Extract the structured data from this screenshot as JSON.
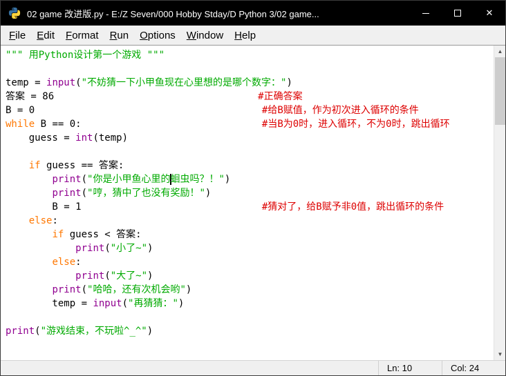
{
  "colors": {
    "titlebar_bg": "#000000",
    "titlebar_text": "#ffffff",
    "menu_bg": "#f0f0f0",
    "editor_bg": "#ffffff",
    "keyword": "#FF7700",
    "builtin": "#900090",
    "string": "#00AA00",
    "comment": "#DD0000",
    "plain": "#000000",
    "python_blue": "#3771a2",
    "python_yellow": "#ffd43b"
  },
  "window": {
    "title": "02 game 改进版.py - E:/Z Seven/000 Hobby Stday/D Python 3/02 game..."
  },
  "menu": {
    "items": [
      {
        "label": "File"
      },
      {
        "label": "Edit"
      },
      {
        "label": "Format"
      },
      {
        "label": "Run"
      },
      {
        "label": "Options"
      },
      {
        "label": "Window"
      },
      {
        "label": "Help"
      }
    ]
  },
  "editor": {
    "lines": [
      [
        {
          "t": "\"\"\" 用Python设计第一个游戏 \"\"\"",
          "c": "s"
        }
      ],
      [],
      [
        {
          "t": "temp = ",
          "c": "p"
        },
        {
          "t": "input",
          "c": "b"
        },
        {
          "t": "(",
          "c": "p"
        },
        {
          "t": "\"不妨猜一下小甲鱼现在心里想的是哪个数字：\"",
          "c": "s"
        },
        {
          "t": ")",
          "c": "p"
        }
      ],
      [
        {
          "t": "答案 = 86",
          "c": "p"
        },
        {
          "t": "                                   ",
          "c": "p"
        },
        {
          "t": "#正确答案",
          "c": "c"
        }
      ],
      [
        {
          "t": "B = 0",
          "c": "p"
        },
        {
          "t": "                                       ",
          "c": "p"
        },
        {
          "t": "#给B赋值，作为初次进入循环的条件",
          "c": "c"
        }
      ],
      [
        {
          "t": "while",
          "c": "k"
        },
        {
          "t": " B == 0:",
          "c": "p"
        },
        {
          "t": "                               ",
          "c": "p"
        },
        {
          "t": "#当B为0时，进入循环，不为0时，跳出循环",
          "c": "c"
        }
      ],
      [
        {
          "t": "    guess = ",
          "c": "p"
        },
        {
          "t": "int",
          "c": "b"
        },
        {
          "t": "(temp)",
          "c": "p"
        }
      ],
      [],
      [
        {
          "t": "    ",
          "c": "p"
        },
        {
          "t": "if",
          "c": "k"
        },
        {
          "t": " guess == 答案:",
          "c": "p"
        }
      ],
      [
        {
          "t": "        ",
          "c": "p"
        },
        {
          "t": "print",
          "c": "b"
        },
        {
          "t": "(",
          "c": "p"
        },
        {
          "t": "\"你是小甲鱼心里的",
          "c": "s"
        },
        {
          "t": "",
          "c": "cursor"
        },
        {
          "t": "蛔虫吗？！\"",
          "c": "s"
        },
        {
          "t": ")",
          "c": "p"
        }
      ],
      [
        {
          "t": "        ",
          "c": "p"
        },
        {
          "t": "print",
          "c": "b"
        },
        {
          "t": "(",
          "c": "p"
        },
        {
          "t": "\"哼，猜中了也没有奖励！\"",
          "c": "s"
        },
        {
          "t": ")",
          "c": "p"
        }
      ],
      [
        {
          "t": "        B = 1",
          "c": "p"
        },
        {
          "t": "                               ",
          "c": "p"
        },
        {
          "t": "#猜对了，给B赋予非0值，跳出循环的条件",
          "c": "c"
        }
      ],
      [
        {
          "t": "    ",
          "c": "p"
        },
        {
          "t": "else",
          "c": "k"
        },
        {
          "t": ":",
          "c": "p"
        }
      ],
      [
        {
          "t": "        ",
          "c": "p"
        },
        {
          "t": "if",
          "c": "k"
        },
        {
          "t": " guess < 答案:",
          "c": "p"
        }
      ],
      [
        {
          "t": "            ",
          "c": "p"
        },
        {
          "t": "print",
          "c": "b"
        },
        {
          "t": "(",
          "c": "p"
        },
        {
          "t": "\"小了~\"",
          "c": "s"
        },
        {
          "t": ")",
          "c": "p"
        }
      ],
      [
        {
          "t": "        ",
          "c": "p"
        },
        {
          "t": "else",
          "c": "k"
        },
        {
          "t": ":",
          "c": "p"
        }
      ],
      [
        {
          "t": "            ",
          "c": "p"
        },
        {
          "t": "print",
          "c": "b"
        },
        {
          "t": "(",
          "c": "p"
        },
        {
          "t": "\"大了~\"",
          "c": "s"
        },
        {
          "t": ")",
          "c": "p"
        }
      ],
      [
        {
          "t": "        ",
          "c": "p"
        },
        {
          "t": "print",
          "c": "b"
        },
        {
          "t": "(",
          "c": "p"
        },
        {
          "t": "\"哈哈，还有次机会哟\"",
          "c": "s"
        },
        {
          "t": ")",
          "c": "p"
        }
      ],
      [
        {
          "t": "        temp = ",
          "c": "p"
        },
        {
          "t": "input",
          "c": "b"
        },
        {
          "t": "(",
          "c": "p"
        },
        {
          "t": "\"再猜猜：\"",
          "c": "s"
        },
        {
          "t": ")",
          "c": "p"
        }
      ],
      [],
      [
        {
          "t": "print",
          "c": "b"
        },
        {
          "t": "(",
          "c": "p"
        },
        {
          "t": "\"游戏结束，不玩啦^_^\"",
          "c": "s"
        },
        {
          "t": ")",
          "c": "p"
        }
      ]
    ]
  },
  "scrollbar": {
    "up": "▲",
    "down": "▼"
  },
  "statusbar": {
    "line": "Ln: 10",
    "col": "Col: 24"
  }
}
